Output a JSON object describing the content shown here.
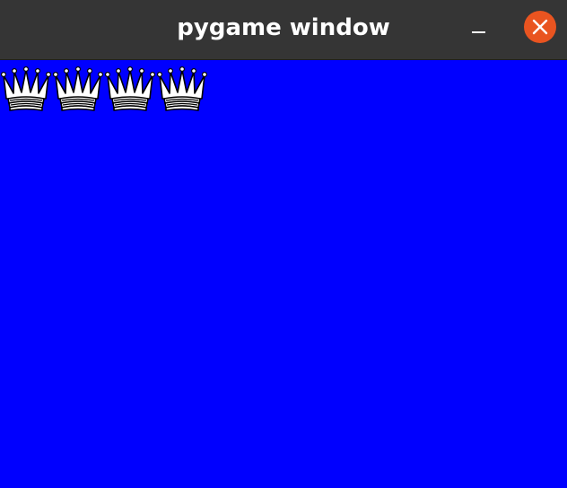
{
  "window": {
    "title": "pygame window",
    "titlebar_color": "#353535",
    "close_button_color": "#e95420"
  },
  "canvas": {
    "background_color": "#0000ff",
    "pieces": [
      {
        "icon": "white-queen-icon"
      },
      {
        "icon": "white-queen-icon"
      },
      {
        "icon": "white-queen-icon"
      },
      {
        "icon": "white-queen-icon"
      }
    ]
  }
}
